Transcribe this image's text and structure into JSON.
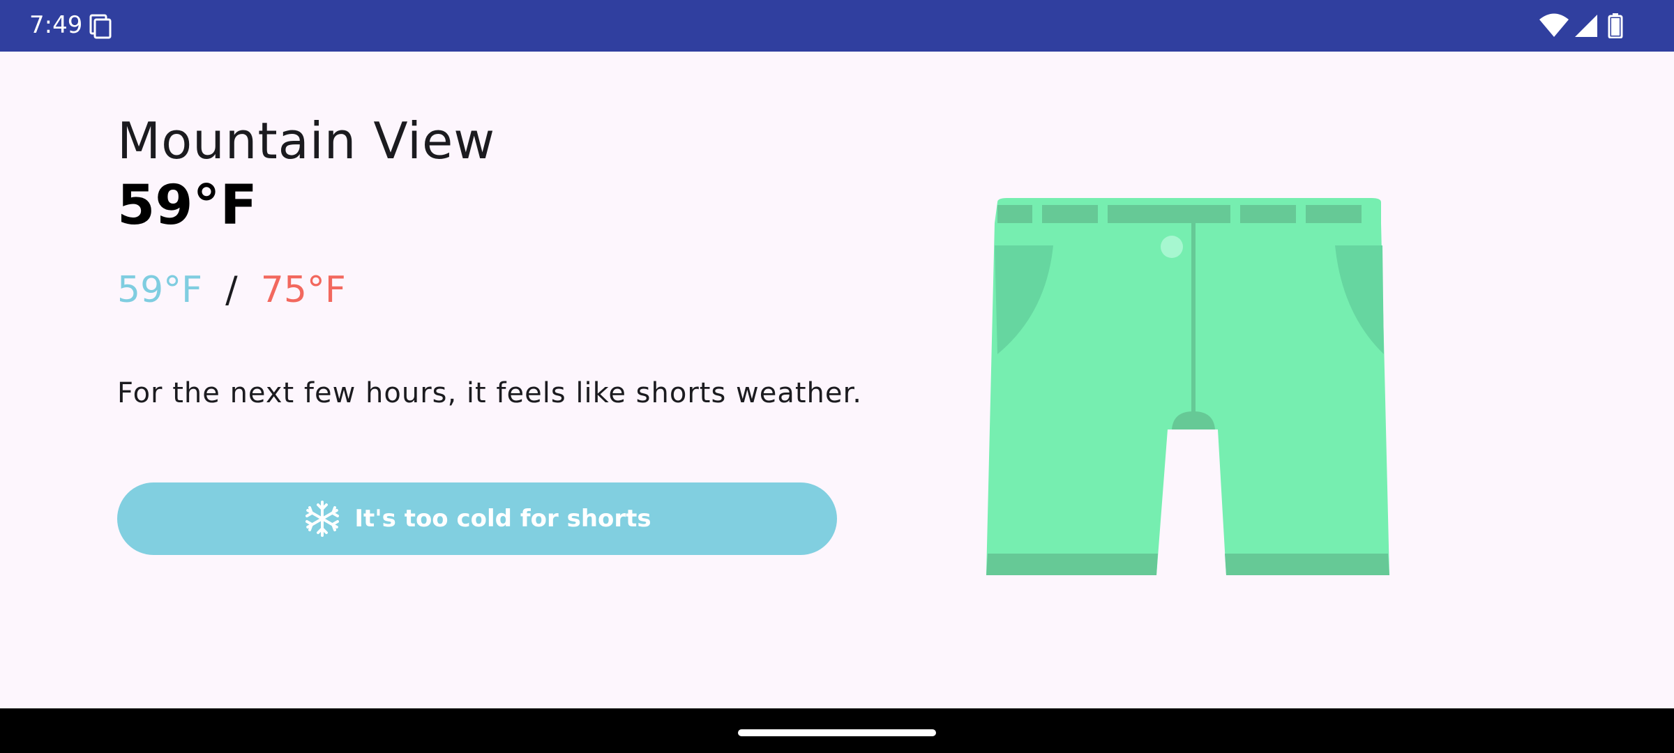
{
  "status_bar": {
    "time": "7:49",
    "icons": [
      "screenshot-icon",
      "wifi-icon",
      "signal-icon",
      "battery-icon"
    ],
    "background": "#303f9f"
  },
  "weather": {
    "city": "Mountain View",
    "current_temp": "59°F",
    "low_temp": "59°F",
    "separator": "/",
    "high_temp": "75°F",
    "message": "For the next few hours, it feels like shorts weather."
  },
  "button": {
    "label": "It's too cold for shorts",
    "icon": "snowflake-icon",
    "color": "#81cfe0"
  },
  "illustration": {
    "icon": "shorts-icon",
    "color": "#76eeb0"
  },
  "colors": {
    "low": "#7fcde0",
    "high": "#f2685e",
    "background": "#fdf6fd"
  }
}
